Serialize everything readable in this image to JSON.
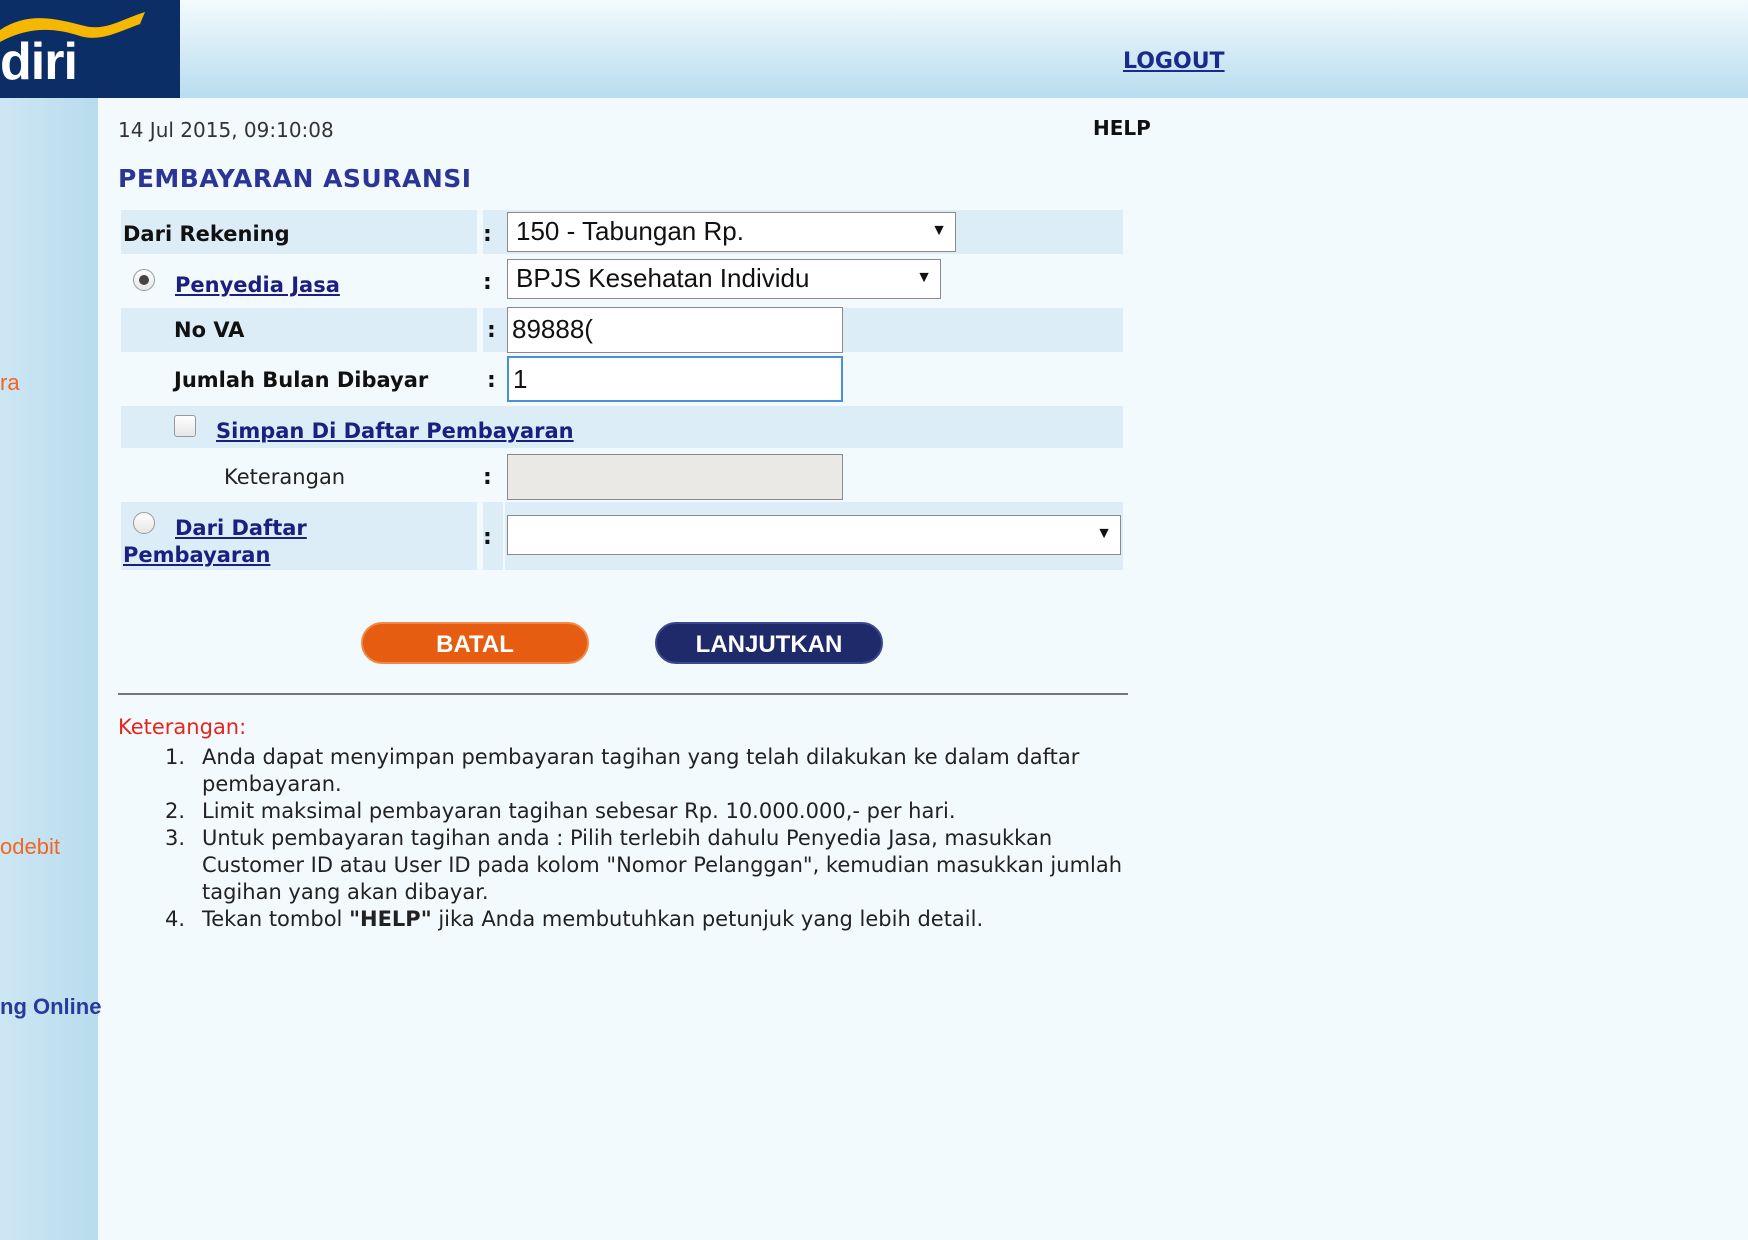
{
  "header": {
    "logo_text": "diri",
    "logout_label": "LOGOUT"
  },
  "sidebar": {
    "items": [
      {
        "label": "ra"
      },
      {
        "label": "odebit"
      },
      {
        "label": "ng Online"
      }
    ]
  },
  "page": {
    "datetime": "14 Jul 2015, 09:10:08",
    "help_label": "HELP",
    "title": "PEMBAYARAN ASURANSI"
  },
  "form": {
    "colon": ":",
    "dari_rekening": {
      "label": "Dari Rekening",
      "value": "150 - Tabungan Rp."
    },
    "penyedia_jasa": {
      "label": "Penyedia Jasa",
      "selected": true,
      "value": "BPJS Kesehatan Individu"
    },
    "no_va": {
      "label": "No VA",
      "value": "89888("
    },
    "jumlah_bulan": {
      "label": "Jumlah Bulan Dibayar",
      "value": "1"
    },
    "simpan": {
      "label": "Simpan Di Daftar Pembayaran",
      "checked": false
    },
    "keterangan": {
      "label": "Keterangan",
      "value": ""
    },
    "dari_daftar": {
      "label_line1": "Dari Daftar",
      "label_line2": "Pembayaran",
      "selected": false,
      "value": ""
    }
  },
  "buttons": {
    "batal": "BATAL",
    "lanjutkan": "LANJUTKAN"
  },
  "notes": {
    "title": "Keterangan:",
    "items": [
      {
        "num": "1.",
        "text": "Anda dapat menyimpan pembayaran tagihan yang telah dilakukan ke dalam daftar pembayaran."
      },
      {
        "num": "2.",
        "text": "Limit maksimal pembayaran tagihan sebesar Rp. 10.000.000,- per hari."
      },
      {
        "num": "3.",
        "text": "Untuk pembayaran tagihan anda : Pilih terlebih dahulu Penyedia Jasa, masukkan Customer ID atau User ID pada kolom \"Nomor Pelanggan\", kemudian masukkan jumlah tagihan yang akan dibayar."
      },
      {
        "num": "4.",
        "text_before": "Tekan tombol ",
        "text_bold": "\"HELP\"",
        "text_after": " jika Anda membutuhkan petunjuk yang lebih detail."
      }
    ]
  },
  "colors": {
    "title_blue": "#2b3595",
    "link_blue": "#1a1f80",
    "row_bg": "#dcedf8",
    "batal_orange": "#e65c10",
    "lanjutkan_navy": "#1f2a6b",
    "note_red": "#e8231d",
    "sidebar_orange": "#f26522"
  }
}
